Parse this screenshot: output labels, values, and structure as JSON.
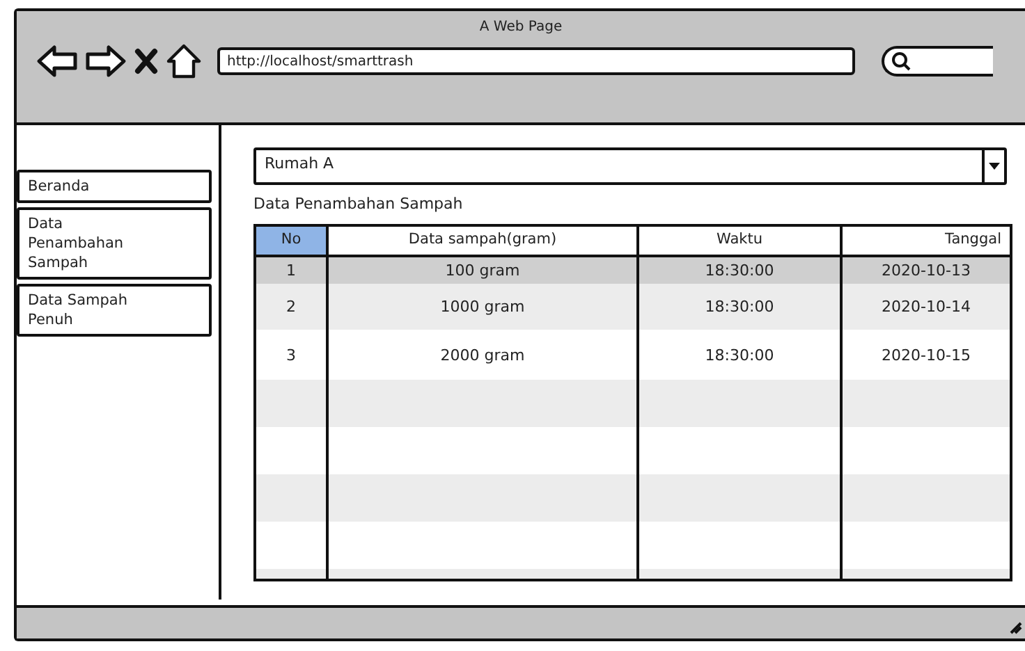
{
  "window": {
    "title": "A Web Page"
  },
  "address_bar": {
    "value": "http://localhost/smarttrash"
  },
  "sidebar": {
    "items": [
      {
        "label": "Beranda"
      },
      {
        "label": "Data Penambahan Sampah"
      },
      {
        "label": "Data Sampah Penuh"
      }
    ]
  },
  "dropdown": {
    "value": "Rumah A"
  },
  "section_title": "Data Penambahan Sampah",
  "table": {
    "columns": [
      {
        "label": "No",
        "selected": true
      },
      {
        "label": "Data sampah(gram)",
        "selected": false
      },
      {
        "label": "Waktu",
        "selected": false
      },
      {
        "label": "Tanggal",
        "selected": false
      }
    ],
    "rows": [
      {
        "cells": [
          "1",
          "100 gram",
          "18:30:00",
          "2020-10-13"
        ],
        "selected": true
      },
      {
        "cells": [
          "2",
          "1000 gram",
          "18:30:00",
          "2020-10-14"
        ],
        "selected": false
      },
      {
        "cells": [
          "3",
          "2000 gram",
          "18:30:00",
          "2020-10-15"
        ],
        "selected": false
      }
    ]
  }
}
